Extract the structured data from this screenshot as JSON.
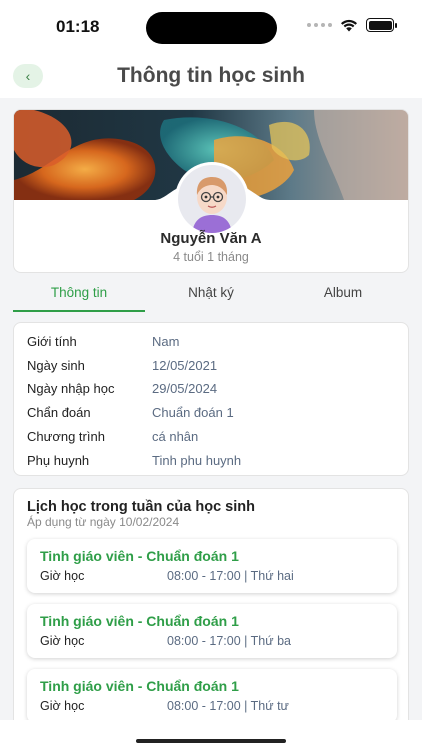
{
  "status_bar": {
    "time": "01:18"
  },
  "header": {
    "title": "Thông tin học sinh",
    "back_icon": "chevron-left-icon"
  },
  "profile": {
    "name": "Nguyễn Văn A",
    "age": "4 tuổi 1 tháng"
  },
  "tabs": [
    {
      "label": "Thông tin",
      "active": true
    },
    {
      "label": "Nhật ký",
      "active": false
    },
    {
      "label": "Album",
      "active": false
    }
  ],
  "info": [
    {
      "label": "Giới tính",
      "value": "Nam"
    },
    {
      "label": "Ngày sinh",
      "value": "12/05/2021"
    },
    {
      "label": "Ngày nhập học",
      "value": "29/05/2024"
    },
    {
      "label": "Chẩn đoán",
      "value": "Chuẩn đoán 1"
    },
    {
      "label": "Chương trình",
      "value": "cá nhân"
    },
    {
      "label": "Phụ huynh",
      "value": "Tinh phu huynh"
    }
  ],
  "schedule": {
    "title": "Lịch học trong tuần của học sinh",
    "subtitle": "Áp dụng từ ngày 10/02/2024",
    "items": [
      {
        "title": "Tinh giáo viên - Chuẩn đoán 1",
        "label": "Giờ học",
        "time": "08:00 - 17:00 | Thứ hai"
      },
      {
        "title": "Tinh giáo viên - Chuẩn đoán 1",
        "label": "Giờ học",
        "time": "08:00 - 17:00 | Thứ ba"
      },
      {
        "title": "Tinh giáo viên - Chuẩn đoán 1",
        "label": "Giờ học",
        "time": "08:00 - 17:00 | Thứ tư"
      }
    ]
  },
  "colors": {
    "accent": "#2f9e48",
    "value_text": "#5b6b82"
  }
}
